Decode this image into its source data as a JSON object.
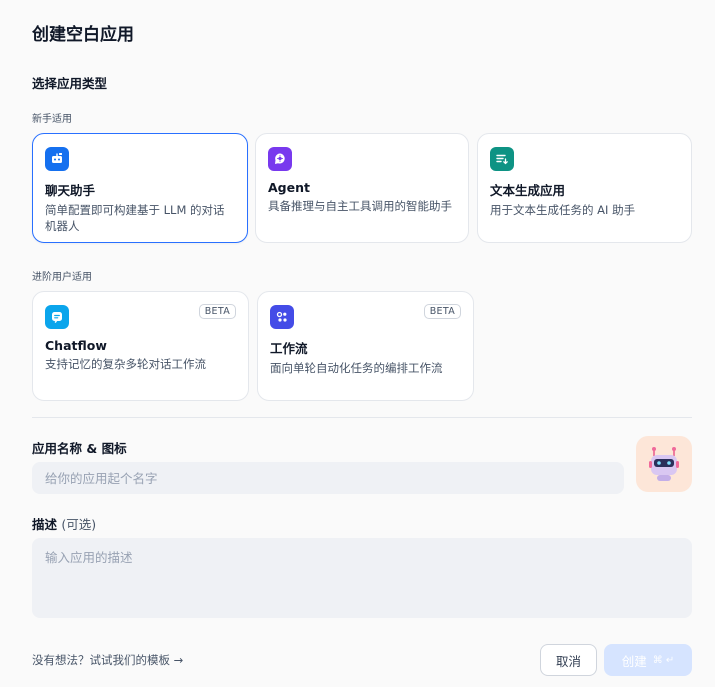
{
  "dialog": {
    "title": "创建空白应用",
    "section_title": "选择应用类型"
  },
  "beginner": {
    "label": "新手适用",
    "cards": [
      {
        "name": "聊天助手",
        "desc": "简单配置即可构建基于 LLM 的对话机器人",
        "icon": "chat-bot-icon",
        "color": "#1570ef",
        "selected": true
      },
      {
        "name": "Agent",
        "desc": "具备推理与自主工具调用的智能助手",
        "icon": "agent-icon",
        "color": "#7839ee",
        "selected": false
      },
      {
        "name": "文本生成应用",
        "desc": "用于文本生成任务的 AI 助手",
        "icon": "text-generation-icon",
        "color": "#0e9384",
        "selected": false
      }
    ]
  },
  "advanced": {
    "label": "进阶用户适用",
    "cards": [
      {
        "name": "Chatflow",
        "desc": "支持记忆的复杂多轮对话工作流",
        "badge": "BETA",
        "icon": "chatflow-icon",
        "color": "#0ba5ec"
      },
      {
        "name": "工作流",
        "desc": "面向单轮自动化任务的编排工作流",
        "badge": "BETA",
        "icon": "workflow-icon",
        "color": "#444ce7"
      }
    ]
  },
  "form": {
    "name_label": "应用名称 & 图标",
    "name_placeholder": "给你的应用起个名字",
    "name_value": "",
    "desc_label": "描述",
    "desc_optional": "(可选)",
    "desc_placeholder": "输入应用的描述",
    "avatar_icon": "robot-icon",
    "avatar_bg": "#fde6d8"
  },
  "footer": {
    "hint": "没有想法？试试我们的模板 →",
    "cancel_label": "取消",
    "create_label": "创建",
    "create_shortcut": "⌘ ↵"
  }
}
